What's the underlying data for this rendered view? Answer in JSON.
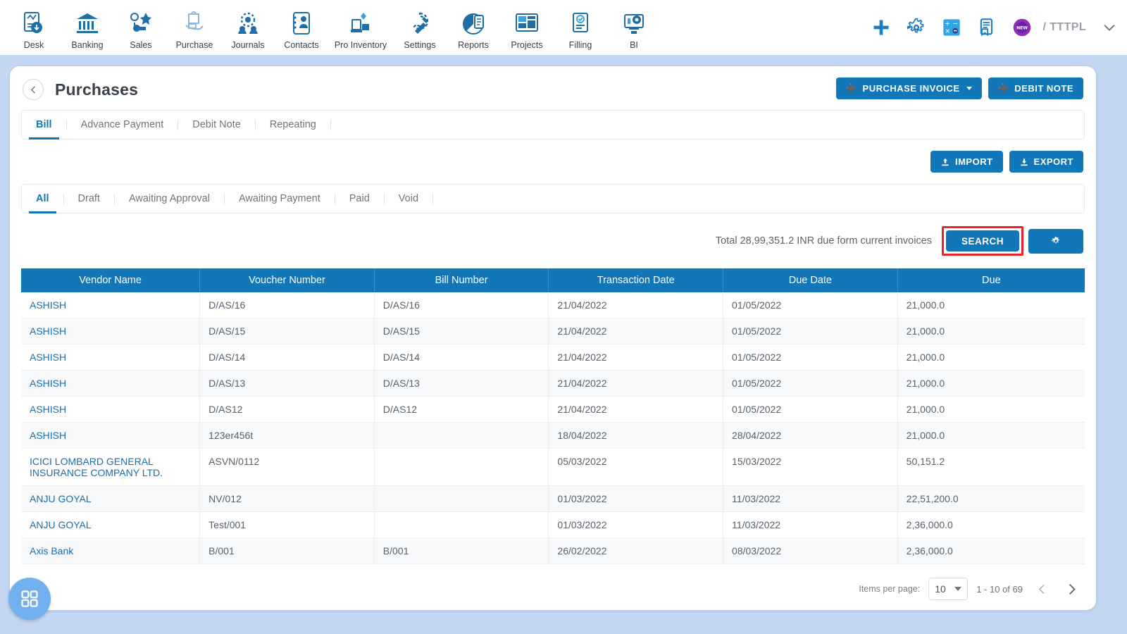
{
  "topnav": {
    "items": [
      {
        "label": "Desk",
        "icon": "dashboard-icon"
      },
      {
        "label": "Banking",
        "icon": "bank-icon"
      },
      {
        "label": "Sales",
        "icon": "sales-icon"
      },
      {
        "label": "Purchase",
        "icon": "purchase-icon"
      },
      {
        "label": "Journals",
        "icon": "journals-icon"
      },
      {
        "label": "Contacts",
        "icon": "contacts-icon"
      },
      {
        "label": "Pro Inventory",
        "icon": "inventory-icon"
      },
      {
        "label": "Settings",
        "icon": "settings-icon"
      },
      {
        "label": "Reports",
        "icon": "reports-icon"
      },
      {
        "label": "Projects",
        "icon": "projects-icon"
      },
      {
        "label": "Filling",
        "icon": "filling-icon"
      },
      {
        "label": "BI",
        "icon": "bi-icon"
      }
    ],
    "right_icons": [
      "plus-icon",
      "gear-icon",
      "calculator-icon",
      "notes-icon",
      "new-badge-icon"
    ],
    "org_label": "/ TTTPL",
    "chevron": "chevron-down-icon"
  },
  "page": {
    "back_icon": "chevron-left-icon",
    "title": "Purchases",
    "actions": [
      {
        "label": "PURCHASE INVOICE",
        "icon": "plus-circle-icon",
        "has_caret": true
      },
      {
        "label": "DEBIT NOTE",
        "icon": "plus-circle-icon",
        "has_caret": false
      }
    ]
  },
  "doc_tabs": {
    "items": [
      {
        "label": "Bill",
        "active": true
      },
      {
        "label": "Advance Payment",
        "active": false
      },
      {
        "label": "Debit Note",
        "active": false
      },
      {
        "label": "Repeating",
        "active": false
      }
    ]
  },
  "io_buttons": [
    {
      "label": "IMPORT",
      "icon": "upload-icon"
    },
    {
      "label": "EXPORT",
      "icon": "download-icon"
    }
  ],
  "status_tabs": {
    "items": [
      {
        "label": "All",
        "active": true
      },
      {
        "label": "Draft",
        "active": false
      },
      {
        "label": "Awaiting Approval",
        "active": false
      },
      {
        "label": "Awaiting Payment",
        "active": false
      },
      {
        "label": "Paid",
        "active": false
      },
      {
        "label": "Void",
        "active": false
      }
    ]
  },
  "search_row": {
    "total_text": "Total 28,99,351.2 INR due form current invoices",
    "search_label": "SEARCH",
    "settings_icon": "gear-icon",
    "highlight_color": "#e8242a"
  },
  "table": {
    "columns": [
      "Vendor Name",
      "Voucher Number",
      "Bill Number",
      "Transaction Date",
      "Due Date",
      "Due"
    ],
    "rows": [
      {
        "vendor": "ASHISH",
        "voucher": "D/AS/16",
        "bill": "D/AS/16",
        "txn_date": "21/04/2022",
        "due_date": "01/05/2022",
        "due": "21,000.0"
      },
      {
        "vendor": "ASHISH",
        "voucher": "D/AS/15",
        "bill": "D/AS/15",
        "txn_date": "21/04/2022",
        "due_date": "01/05/2022",
        "due": "21,000.0"
      },
      {
        "vendor": "ASHISH",
        "voucher": "D/AS/14",
        "bill": "D/AS/14",
        "txn_date": "21/04/2022",
        "due_date": "01/05/2022",
        "due": "21,000.0"
      },
      {
        "vendor": "ASHISH",
        "voucher": "D/AS/13",
        "bill": "D/AS/13",
        "txn_date": "21/04/2022",
        "due_date": "01/05/2022",
        "due": "21,000.0"
      },
      {
        "vendor": "ASHISH",
        "voucher": "D/AS12",
        "bill": "D/AS12",
        "txn_date": "21/04/2022",
        "due_date": "01/05/2022",
        "due": "21,000.0"
      },
      {
        "vendor": "ASHISH",
        "voucher": "123er456t",
        "bill": "",
        "txn_date": "18/04/2022",
        "due_date": "28/04/2022",
        "due": "21,000.0"
      },
      {
        "vendor": "ICICI LOMBARD GENERAL INSURANCE COMPANY LTD.",
        "voucher": "ASVN/0112",
        "bill": "",
        "txn_date": "05/03/2022",
        "due_date": "15/03/2022",
        "due": "50,151.2"
      },
      {
        "vendor": "ANJU GOYAL",
        "voucher": "NV/012",
        "bill": "",
        "txn_date": "01/03/2022",
        "due_date": "11/03/2022",
        "due": "22,51,200.0"
      },
      {
        "vendor": "ANJU GOYAL",
        "voucher": "Test/001",
        "bill": "",
        "txn_date": "01/03/2022",
        "due_date": "11/03/2022",
        "due": "2,36,000.0"
      },
      {
        "vendor": "Axis Bank",
        "voucher": "B/001",
        "bill": "B/001",
        "txn_date": "26/02/2022",
        "due_date": "08/03/2022",
        "due": "2,36,000.0"
      }
    ]
  },
  "paginator": {
    "items_per_page_label": "Items per page:",
    "items_per_page_value": "10",
    "range_text": "1 - 10 of 69",
    "prev_icon": "chevron-left-icon",
    "next_icon": "chevron-right-icon"
  },
  "fab": {
    "icon": "apps-grid-icon"
  },
  "colors": {
    "brand_blue": "#1277b8",
    "page_bg": "#c3d6f2",
    "link_blue": "#1a6ea8",
    "highlight_red": "#e8242a",
    "fab_blue": "#72b0f0"
  }
}
